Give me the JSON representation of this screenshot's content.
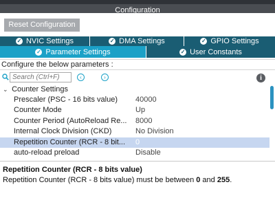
{
  "window": {
    "title": "Configuration"
  },
  "toolbar": {
    "reset_label": "Reset Configuration"
  },
  "tabs": {
    "row1": [
      {
        "label": "NVIC Settings"
      },
      {
        "label": "DMA Settings"
      },
      {
        "label": "GPIO Settings"
      }
    ],
    "row2": [
      {
        "label": "Parameter Settings",
        "active": true
      },
      {
        "label": "User Constants"
      }
    ]
  },
  "hint": "Configure the below parameters :",
  "search": {
    "placeholder": "Search (Ctrl+F)"
  },
  "tree": {
    "group_label": "Counter Settings",
    "rows": [
      {
        "name": "Prescaler (PSC - 16 bits value)",
        "value": "40000"
      },
      {
        "name": "Counter Mode",
        "value": "Up"
      },
      {
        "name": "Counter Period (AutoReload Re...",
        "value": "8000"
      },
      {
        "name": "Internal Clock Division (CKD)",
        "value": "No Division"
      },
      {
        "name": "Repetition Counter (RCR - 8 bit...",
        "value": "0",
        "selected": true
      },
      {
        "name": "auto-reload preload",
        "value": "Disable"
      }
    ]
  },
  "description": {
    "title": "Repetition Counter (RCR - 8 bits value)",
    "text_prefix": "Repetition Counter (RCR - 8 bits value) must be between ",
    "min": "0",
    "text_mid": " and ",
    "max": "255",
    "text_suffix": "."
  },
  "colors": {
    "tab_dark": "#1a5d73",
    "tab_active": "#1ba1c7",
    "selected_row": "#c6d6f0",
    "title_bar": "#4a4d52"
  }
}
